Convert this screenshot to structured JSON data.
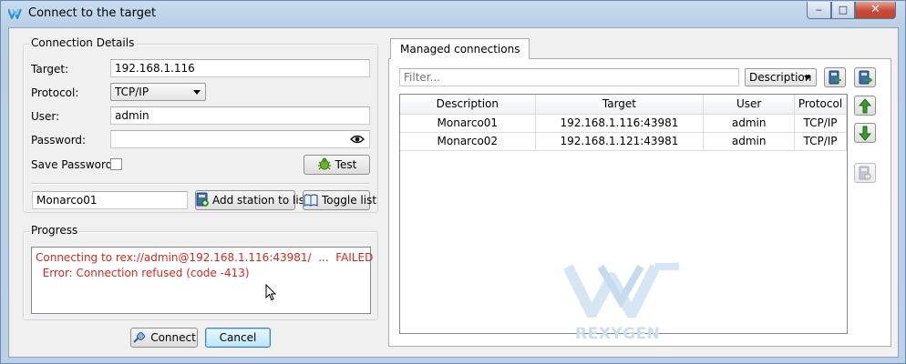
{
  "window": {
    "title": "Connect to the target",
    "minimize_label": "‒",
    "maximize_label": "□",
    "close_label": "✕"
  },
  "connection": {
    "group_title": "Connection Details",
    "target_label": "Target:",
    "target_value": "192.168.1.116",
    "protocol_label": "Protocol:",
    "protocol_value": "TCP/IP",
    "user_label": "User:",
    "user_value": "admin",
    "password_label": "Password:",
    "password_value": "",
    "save_password_label": "Save Password:",
    "save_password_checked": false,
    "test_label": "Test",
    "station_name_value": "Monarco01",
    "add_station_label": "Add station to list",
    "toggle_list_label": "Toggle list"
  },
  "progress": {
    "group_title": "Progress",
    "lines": [
      "Connecting to rex://admin@192.168.1.116:43981/  ...  FAILED",
      "  Error: Connection refused (code -413)"
    ],
    "text_color": "#d4281f"
  },
  "footer": {
    "connect_label": "Connect",
    "cancel_label": "Cancel"
  },
  "managed": {
    "tab_label": "Managed connections",
    "filter_placeholder": "Filter...",
    "filter_value": "",
    "filter_column": "Description",
    "columns": [
      "Description",
      "Target",
      "User",
      "Protocol"
    ],
    "rows": [
      [
        "Monarco01",
        "192.168.1.116:43981",
        "admin",
        "TCP/IP"
      ],
      [
        "Monarco02",
        "192.168.1.121:43981",
        "admin",
        "TCP/IP"
      ]
    ],
    "watermark_text": "REXYGEN"
  },
  "icons": {
    "app": "rexygen-logo-icon",
    "eye": "eye-icon",
    "test": "bug-icon",
    "add_station": "add-station-icon",
    "toggle_list": "book-icon",
    "connect": "plug-icon",
    "import": "import-icon",
    "export": "export-icon",
    "up": "arrow-up-icon",
    "down": "arrow-down-icon",
    "delete": "delete-icon"
  },
  "colors": {
    "title_gradient": "#c9dcef",
    "close_button": "#c74a36",
    "error_text": "#d4281f",
    "watermark": "#c9deef",
    "arrow_green": "#3a9a2e"
  }
}
